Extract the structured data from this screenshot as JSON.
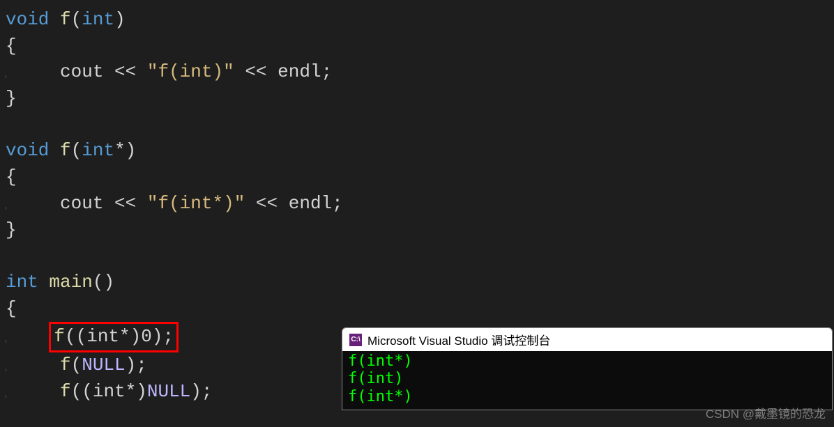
{
  "code": {
    "void": "void",
    "int": "int",
    "f": "f",
    "main": "main",
    "cout": "cout",
    "lshift": "<<",
    "endl": "endl",
    "str_fint": "\"f(int)\"",
    "str_fintp": "\"f(int*)\"",
    "null": "NULL",
    "cast": "(int*)",
    "zero": "0"
  },
  "console": {
    "icon_text": "C:\\",
    "title": "Microsoft Visual Studio 调试控制台",
    "lines": {
      "l1": "f(int*)",
      "l2": "f(int)",
      "l3": "f(int*)"
    }
  },
  "watermark": "CSDN @戴墨镜的恐龙"
}
